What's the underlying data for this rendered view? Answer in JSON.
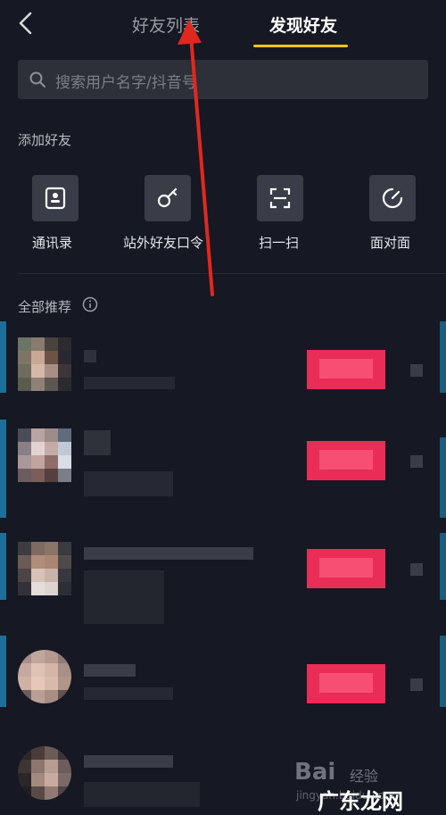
{
  "header": {
    "tab_friends": "好友列表",
    "tab_discover": "发现好友",
    "accent_color": "#f5c518"
  },
  "search": {
    "placeholder": "搜索用户名字/抖音号"
  },
  "add_friends": {
    "title": "添加好友",
    "actions": [
      {
        "label": "通讯录",
        "icon": "contact-card-icon"
      },
      {
        "label": "站外好友口令",
        "icon": "key-icon"
      },
      {
        "label": "扫一扫",
        "icon": "scan-icon"
      },
      {
        "label": "面对面",
        "icon": "face-to-face-icon"
      }
    ]
  },
  "recommendations": {
    "title": "全部推荐",
    "info_icon": "info-icon",
    "follow_color": "#ea2d56",
    "rows": [
      {
        "name_pixelated": true
      },
      {
        "name_pixelated": true
      },
      {
        "name_pixelated": true
      },
      {
        "name_pixelated": true
      },
      {
        "name_pixelated": true
      }
    ]
  },
  "watermark": {
    "brand": "Bai",
    "brand_sub": "经验",
    "url": "jingyan.baidu.com",
    "site": "广东龙网"
  }
}
